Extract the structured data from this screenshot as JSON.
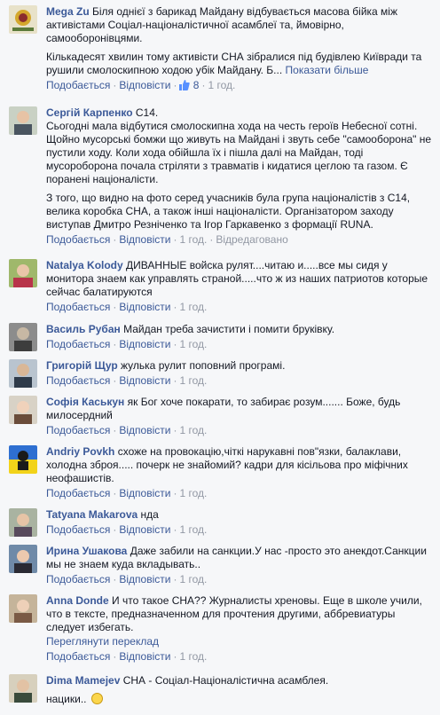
{
  "comments": [
    {
      "author": "Mega Zu",
      "text": "Біля однієї з барикад Майдану відбувається масова бійка між активістами Соціал-націоналістичної асамблеї та, ймовірно, самооборонівцями.",
      "text2": "Кількадесят хвилин тому активісти СНА зібралися під будівлею Київради та рушили смолоскипною ходою убік Майдану. Б...",
      "see_more": "Показати більше",
      "like": "Подобається",
      "reply": "Відповісти",
      "likes": "8",
      "time": "1 год."
    },
    {
      "author": "Сергій Карпенко",
      "text": "С14.\nСьогодні мала відбутися смолоскипна хода на честь героїв Небесної сотні. Щойно мусорські бомжи що живуть на Майдані і звуть себе \"самооборона\" не пустили ходу. Коли хода обійшла їх і пішла далі на Майдан, тоді мусороборона почала стріляти з травматів і кидатися цеглою та газом. Є поранені націоналісти.",
      "text2": "З того, що видно на фото серед учасників була група націоналістів з С14, велика коробка СНА, а також інші націоналісти. Організатором заходу виступав Дмитро Резніченко та Ігор Гаркавенко з формації RUNA.",
      "like": "Подобається",
      "reply": "Відповісти",
      "time": "1 год.",
      "edited": "Відредаговано"
    },
    {
      "author": "Natalya Kolody",
      "text": "ДИВАННЫЕ войска рулят....читаю и.....все мы сидя у монитора знаем как управлять страной.....что ж из наших патриотов которые сейчас балатируются",
      "like": "Подобається",
      "reply": "Відповісти",
      "time": "1 год."
    },
    {
      "author": "Василь Рубан",
      "text": "Майдан треба зачистити і помити бруківку.",
      "like": "Подобається",
      "reply": "Відповісти",
      "time": "1 год."
    },
    {
      "author": "Григорій Щур",
      "text": "жулька рулит поповний програмі.",
      "like": "Подобається",
      "reply": "Відповісти",
      "time": "1 год."
    },
    {
      "author": "Софія Каськун",
      "text": "як Бог хоче покарати, то забирає розум....... Боже, будь милосердний",
      "like": "Подобається",
      "reply": "Відповісти",
      "time": "1 год."
    },
    {
      "author": "Andriy Povkh",
      "text": "схоже на провокацію,чіткі нарукавні пов\"язки, балаклави, холодна зброя..... почерк не знайомий? кадри для кісільова про міфічних неофашистів.",
      "like": "Подобається",
      "reply": "Відповісти",
      "time": "1 год."
    },
    {
      "author": "Tatyana Makarova",
      "text": "нда",
      "like": "Подобається",
      "reply": "Відповісти",
      "time": "1 год."
    },
    {
      "author": "Ирина Ушакова",
      "text": "Даже забили на санкции.У нас -просто это анекдот.Санкции мы не знаем куда вкладывать..",
      "like": "Подобається",
      "reply": "Відповісти",
      "time": "1 год."
    },
    {
      "author": "Anna Donde",
      "text": "И что такое СНА?? Журналисты хреновы. Еще в школе учили, что в тексте, предназначенном для прочтения другими, аббревиатуры следует избегать.",
      "translate": "Переглянути переклад",
      "like": "Подобається",
      "reply": "Відповісти",
      "time": "1 год."
    },
    {
      "author": "Dima Mamejev",
      "text": "СНА - Соціал-Націоналістична асамблея.",
      "text2": "нацики..",
      "like": "Подобається",
      "reply": "Відповісти",
      "time": "1 год."
    }
  ],
  "colors": {
    "link": "#3b5998",
    "meta": "#9197a3",
    "text": "#141823",
    "background": "#f6f7f9"
  }
}
